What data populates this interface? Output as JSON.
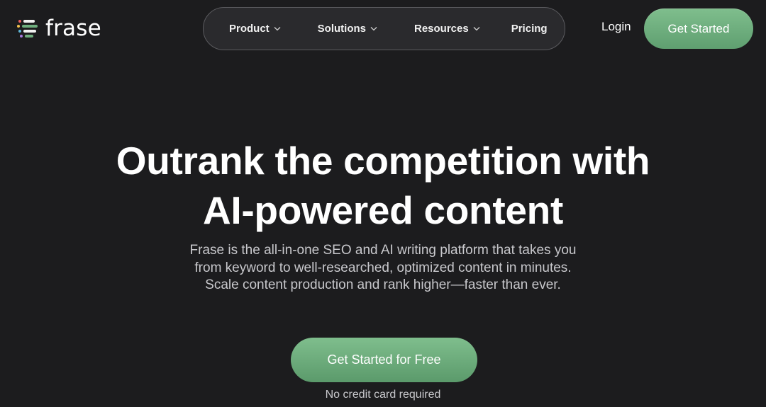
{
  "header": {
    "logo_text": "frase",
    "logo_icon": "frase-logo-icon",
    "nav": [
      {
        "label": "Product",
        "has_dropdown": true
      },
      {
        "label": "Solutions",
        "has_dropdown": true
      },
      {
        "label": "Resources",
        "has_dropdown": true
      },
      {
        "label": "Pricing",
        "has_dropdown": false
      }
    ],
    "login_label": "Login",
    "get_started_label": "Get Started"
  },
  "hero": {
    "title_line1": "Outrank the competition with",
    "title_line2": "AI-powered content",
    "subtitle_line1": "Frase is the all-in-one SEO and AI writing platform that takes you",
    "subtitle_line2": "from keyword to well-researched, optimized content in minutes.",
    "subtitle_line3": "Scale content production and rank higher—faster than ever.",
    "cta_label": "Get Started for Free",
    "cta_note": "No credit card required"
  },
  "colors": {
    "background": "#1c1c1e",
    "accent_green": "#6fae7e",
    "text_muted": "#c8c8cc"
  }
}
